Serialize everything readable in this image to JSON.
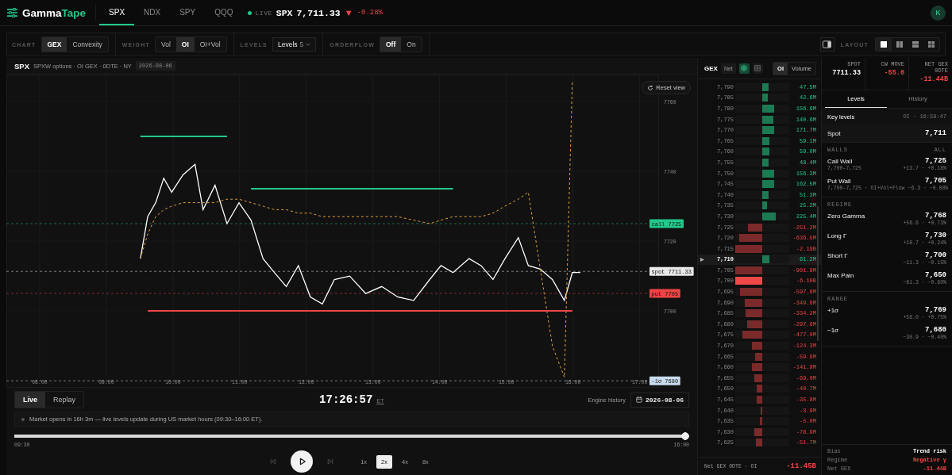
{
  "nav": {
    "logo": {
      "first": "Gamma",
      "second": "Tape"
    },
    "tabs": [
      {
        "label": "SPX",
        "selected": true
      },
      {
        "label": "NDX",
        "selected": false
      },
      {
        "label": "SPY",
        "selected": false
      },
      {
        "label": "QQQ",
        "selected": false
      }
    ],
    "ticker": {
      "status": "LIVE",
      "symbol": "SPX",
      "price": "7,711.33",
      "arrow": "▼",
      "change": "-0.28%"
    },
    "avatar": "K"
  },
  "toolbar": {
    "groups": [
      {
        "label": "CHART",
        "kind": "segmented",
        "options": [
          {
            "label": "GEX",
            "selected": true
          },
          {
            "label": "Convexity",
            "selected": false
          }
        ]
      },
      {
        "label": "WEIGHT",
        "kind": "segmented",
        "options": [
          {
            "label": "Vol",
            "selected": false
          },
          {
            "label": "OI",
            "selected": true
          },
          {
            "label": "OI+Vol",
            "selected": false
          }
        ]
      },
      {
        "label": "LEVELS",
        "kind": "dropdown",
        "value": "Levels",
        "count": "5"
      },
      {
        "label": "ORDERFLOW",
        "kind": "segmented",
        "options": [
          {
            "label": "Off",
            "selected": true
          },
          {
            "label": "On",
            "selected": false
          }
        ]
      }
    ],
    "layout_label": "LAYOUT",
    "layouts": [
      {
        "kind": "single",
        "selected": true
      },
      {
        "kind": "columns",
        "selected": false
      },
      {
        "kind": "rows",
        "selected": false
      },
      {
        "kind": "grid",
        "selected": false
      }
    ]
  },
  "chart_panel": {
    "symbol": "SPX",
    "subtitle": "SPXW options · OI GEX · 0DTE · NY",
    "date": "2026-08-06",
    "reset": "Reset view",
    "chart_data": {
      "type": "line",
      "grid": true,
      "x": [
        9.51,
        9.62,
        9.74,
        9.86,
        9.98,
        10.15,
        10.33,
        10.45,
        10.63,
        10.81,
        10.99,
        11.17,
        11.35,
        11.52,
        11.7,
        11.88,
        12.06,
        12.24,
        12.42,
        12.65,
        12.89,
        13.13,
        13.37,
        13.61,
        13.85,
        14.02,
        14.2,
        14.44,
        14.62,
        14.8,
        14.98,
        15.18,
        15.33,
        15.51,
        15.69,
        15.87,
        15.99,
        16.11
      ],
      "series": [
        {
          "color": "#ffffff",
          "line_style": "solid",
          "values": [
            7715,
            7727,
            7731,
            7738,
            7734,
            7739,
            7742,
            7729,
            7736,
            7725,
            7731,
            7726,
            7715,
            7711,
            7707,
            7713,
            7704,
            7702,
            7709,
            7710,
            7705,
            7707,
            7704,
            7703,
            7709,
            7713,
            7711,
            7715,
            7713,
            7709,
            7715,
            7721,
            7713,
            7712,
            7709,
            7703,
            7711,
            7711
          ]
        },
        {
          "color": "#e0a040",
          "line_style": "dashed",
          "values": [
            7715,
            7722,
            7727,
            7729,
            7730,
            7731,
            7731,
            7731,
            7731,
            7732,
            7732,
            7731,
            7730,
            7729,
            7729,
            7728,
            7728,
            7727,
            7727,
            7727,
            7727,
            7727,
            7727,
            7726,
            7725,
            7726,
            7727,
            7727,
            7727,
            7728,
            7730,
            7732,
            7734,
            7712,
            7690,
            7681,
            7766,
            null
          ]
        },
        {
          "color": "#22c98a",
          "line_style": "solid",
          "values": [
            7750,
            7750,
            7750,
            7750,
            7750,
            7750,
            7750,
            7750,
            7750,
            7750,
            null,
            7735,
            7735,
            7735,
            7735,
            7735,
            7735,
            7735,
            7735,
            7735,
            7735,
            7735,
            7735,
            7735,
            7735,
            7735,
            7735,
            null,
            null,
            null,
            null,
            null,
            null,
            null,
            null,
            null,
            null,
            null
          ]
        },
        {
          "color": "#ef4444",
          "line_style": "solid",
          "values": [
            null,
            7700,
            7700,
            7700,
            7700,
            7700,
            7700,
            7700,
            7700,
            7700,
            7700,
            7700,
            7700,
            7700,
            7700,
            7700,
            7700,
            7700,
            7700,
            7700,
            7700,
            7700,
            7700,
            7700,
            7700,
            7700,
            7700,
            7700,
            7700,
            7700,
            7700,
            7700,
            7700,
            7700,
            7700,
            7700,
            7700,
            null
          ]
        }
      ],
      "xticks": [
        {
          "value": 8,
          "label": "08:00"
        },
        {
          "value": 9,
          "label": "09:00"
        },
        {
          "value": 10,
          "label": "10:00"
        },
        {
          "value": 11,
          "label": "11:00"
        },
        {
          "value": 12,
          "label": "12:00"
        },
        {
          "value": 13,
          "label": "13:00"
        },
        {
          "value": 14,
          "label": "14:00"
        },
        {
          "value": 15,
          "label": "15:00"
        },
        {
          "value": 16,
          "label": "16:00"
        },
        {
          "value": 17,
          "label": "17:00"
        }
      ],
      "yticks": [
        7700,
        7720,
        7740,
        7760
      ],
      "xlim": [
        7.5,
        17.29
      ],
      "ylim": [
        7678,
        7767.7
      ],
      "ref_lines": [
        {
          "axis": "y",
          "value": 7725,
          "label": "call 7725",
          "color": "#22c98a"
        },
        {
          "axis": "y",
          "value": 7711.33,
          "label": "spot 7711.33",
          "color": "#e8e8e8"
        },
        {
          "axis": "y",
          "value": 7705,
          "label": "put 7705",
          "color": "#ef4444"
        },
        {
          "axis": "y",
          "value": 7680,
          "label": "-1σ 7680",
          "color": "#c9dcef"
        }
      ]
    }
  },
  "replay": {
    "modes": [
      {
        "label": "Live",
        "selected": true
      },
      {
        "label": "Replay",
        "selected": false
      }
    ],
    "clock": "17:26:57",
    "zone": "ET",
    "history_label": "Engine history",
    "date": "2026-08-06",
    "notice": "Market opens in 16h 3m — live levels update during US market hours (09:30–16:00 ET).",
    "slider": {
      "level": 1,
      "start": "09:30",
      "end": "16:00"
    },
    "controls": [
      {
        "kind": "prev",
        "disabled": true
      },
      {
        "kind": "play",
        "disabled": false
      },
      {
        "kind": "next",
        "disabled": true
      }
    ],
    "speeds": [
      {
        "label": "1x",
        "selected": false
      },
      {
        "label": "2x",
        "selected": true
      },
      {
        "label": "4x",
        "selected": false
      },
      {
        "label": "8x",
        "selected": false
      }
    ]
  },
  "ladder": {
    "title": "GEX",
    "toggles": [
      {
        "kind": "text",
        "label": "Net",
        "selected": false
      },
      {
        "kind": "target",
        "selected": true
      },
      {
        "kind": "grid",
        "selected": false
      }
    ],
    "modes": [
      {
        "label": "OI",
        "selected": true
      },
      {
        "label": "Volume",
        "selected": false
      }
    ],
    "rows": [
      {
        "strike": "7,790",
        "value": "47.5M",
        "kind": "call",
        "level": 0.24,
        "current": false,
        "peak": false
      },
      {
        "strike": "7,785",
        "value": "42.6M",
        "kind": "call",
        "level": 0.22,
        "current": false,
        "peak": false
      },
      {
        "strike": "7,780",
        "value": "156.6M",
        "kind": "call",
        "level": 0.44,
        "current": false,
        "peak": false
      },
      {
        "strike": "7,775",
        "value": "140.6M",
        "kind": "call",
        "level": 0.41,
        "current": false,
        "peak": false
      },
      {
        "strike": "7,770",
        "value": "171.7M",
        "kind": "call",
        "level": 0.45,
        "current": false,
        "peak": false
      },
      {
        "strike": "7,765",
        "value": "59.1M",
        "kind": "call",
        "level": 0.26,
        "current": false,
        "peak": false
      },
      {
        "strike": "7,760",
        "value": "59.0M",
        "kind": "call",
        "level": 0.26,
        "current": false,
        "peak": false
      },
      {
        "strike": "7,755",
        "value": "48.4M",
        "kind": "call",
        "level": 0.24,
        "current": false,
        "peak": false
      },
      {
        "strike": "7,750",
        "value": "156.3M",
        "kind": "call",
        "level": 0.44,
        "current": false,
        "peak": false
      },
      {
        "strike": "7,745",
        "value": "162.5M",
        "kind": "call",
        "level": 0.44,
        "current": false,
        "peak": false
      },
      {
        "strike": "7,740",
        "value": "51.3M",
        "kind": "call",
        "level": 0.24,
        "current": false,
        "peak": false
      },
      {
        "strike": "7,735",
        "value": "25.2M",
        "kind": "call",
        "level": 0.17,
        "current": false,
        "peak": false
      },
      {
        "strike": "7,730",
        "value": "225.4M",
        "kind": "call",
        "level": 0.5,
        "current": false,
        "peak": false
      },
      {
        "strike": "7,725",
        "value": "-251.2M",
        "kind": "put",
        "level": 0.53,
        "current": false,
        "peak": false
      },
      {
        "strike": "7,720",
        "value": "-636.5M",
        "kind": "put",
        "level": 0.85,
        "current": false,
        "peak": false
      },
      {
        "strike": "7,715",
        "value": "-2.19B",
        "kind": "put",
        "level": 1,
        "current": false,
        "peak": false
      },
      {
        "strike": "7,710",
        "value": "61.2M",
        "kind": "call",
        "level": 0.26,
        "current": true,
        "peak": false
      },
      {
        "strike": "7,705",
        "value": "-901.9M",
        "kind": "put",
        "level": 1,
        "current": false,
        "peak": false
      },
      {
        "strike": "7,700",
        "value": "-6.10B",
        "kind": "put",
        "level": 1,
        "current": false,
        "peak": true
      },
      {
        "strike": "7,695",
        "value": "-597.8M",
        "kind": "put",
        "level": 0.82,
        "current": false,
        "peak": false
      },
      {
        "strike": "7,690",
        "value": "-349.6M",
        "kind": "put",
        "level": 0.65,
        "current": false,
        "peak": false
      },
      {
        "strike": "7,685",
        "value": "-334.2M",
        "kind": "put",
        "level": 0.62,
        "current": false,
        "peak": false
      },
      {
        "strike": "7,680",
        "value": "-297.6M",
        "kind": "put",
        "level": 0.56,
        "current": false,
        "peak": false
      },
      {
        "strike": "7,675",
        "value": "-477.0M",
        "kind": "put",
        "level": 0.74,
        "current": false,
        "peak": false
      },
      {
        "strike": "7,670",
        "value": "-124.3M",
        "kind": "put",
        "level": 0.38,
        "current": false,
        "peak": false
      },
      {
        "strike": "7,665",
        "value": "-59.6M",
        "kind": "put",
        "level": 0.26,
        "current": false,
        "peak": false
      },
      {
        "strike": "7,660",
        "value": "-141.9M",
        "kind": "put",
        "level": 0.38,
        "current": false,
        "peak": false
      },
      {
        "strike": "7,655",
        "value": "-69.0M",
        "kind": "put",
        "level": 0.29,
        "current": false,
        "peak": false
      },
      {
        "strike": "7,650",
        "value": "-40.7M",
        "kind": "put",
        "level": 0.21,
        "current": false,
        "peak": false
      },
      {
        "strike": "7,645",
        "value": "-35.8M",
        "kind": "put",
        "level": 0.21,
        "current": false,
        "peak": false
      },
      {
        "strike": "7,640",
        "value": "-3.9M",
        "kind": "put",
        "level": 0.07,
        "current": false,
        "peak": false
      },
      {
        "strike": "7,635",
        "value": "-5.0M",
        "kind": "put",
        "level": 0.09,
        "current": false,
        "peak": false
      },
      {
        "strike": "7,630",
        "value": "-78.9M",
        "kind": "put",
        "level": 0.29,
        "current": false,
        "peak": false
      },
      {
        "strike": "7,625",
        "value": "-51.7M",
        "kind": "put",
        "level": 0.24,
        "current": false,
        "peak": false
      }
    ],
    "footer_label": "Net GEX 0DTE · OI",
    "footer_value": "-11.45B"
  },
  "levels_panel": {
    "stats": [
      {
        "label": "SPOT",
        "value": "7711.33",
        "color": "#ffffff"
      },
      {
        "label": "CW MOVE",
        "value": "-55.0",
        "color": "#ef4444"
      },
      {
        "label": "NET GEX 0DTE",
        "value": "-11.44B",
        "color": "#ef4444"
      }
    ],
    "tabs": [
      {
        "label": "Levels",
        "selected": true
      },
      {
        "label": "History",
        "selected": false
      }
    ],
    "key_title": "Key levels",
    "key_meta": "OI · 16:59:47",
    "spot": {
      "label": "Spot",
      "value": "7,711"
    },
    "sections": [
      {
        "title": "WALLS",
        "aside": "ALL",
        "items": [
          {
            "label": "Call Wall",
            "value": "7,725",
            "detail": "7,700–7,725",
            "change": "+13.7 · +0.18%"
          },
          {
            "label": "Put Wall",
            "value": "7,705",
            "detail": "7,700–7,725 · OI+Vol+Flow",
            "change": "−6.3 · −0.08%"
          }
        ]
      },
      {
        "title": "REGIME",
        "items": [
          {
            "label": "Zero Gamma",
            "value": "7,768",
            "change": "+56.6 · +0.73%"
          },
          {
            "label": "Long Γ",
            "value": "7,730",
            "change": "+18.7 · +0.24%"
          },
          {
            "label": "Short Γ",
            "value": "7,700",
            "change": "−11.3 · −0.15%"
          },
          {
            "label": "Max Pain",
            "value": "7,650",
            "change": "−61.3 · −0.80%"
          }
        ]
      },
      {
        "title": "RANGE",
        "items": [
          {
            "label": "+1σ",
            "value": "7,769",
            "change": "+58.0 · +0.75%"
          },
          {
            "label": "−1σ",
            "value": "7,680",
            "change": "−30.9 · −0.40%"
          }
        ]
      }
    ],
    "summary": [
      {
        "label": "Bias",
        "value": "Trend risk",
        "color": "#ffffff"
      },
      {
        "label": "Regime",
        "value": "Negative γ",
        "color": "#ef4444"
      },
      {
        "label": "Net GEX",
        "value": "-11.44B",
        "color": "#ef4444"
      }
    ]
  }
}
